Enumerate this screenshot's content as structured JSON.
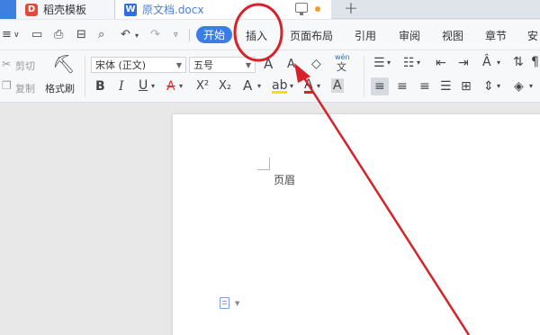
{
  "tabs": [
    {
      "label": "稻壳模板",
      "logo": "D"
    },
    {
      "label": "原文档.docx",
      "logo": "W"
    }
  ],
  "tab_bar": {
    "plus": "+"
  },
  "menu": {
    "start": "开始",
    "items": [
      "插入",
      "页面布局",
      "引用",
      "审阅",
      "视图",
      "章节",
      "安"
    ]
  },
  "clipboard": {
    "cut": "剪切",
    "copy": "复制",
    "format_painter": "格式刷"
  },
  "font": {
    "family": "宋体 (正文)",
    "size": "五号"
  },
  "ribbon_glyphs": {
    "bold": "B",
    "italic": "I",
    "underline": "U",
    "strike": "A",
    "superscript": "X²",
    "subscript": "X₂",
    "grow": "A",
    "shrink": "A",
    "phonetic": "wén",
    "phonetic_char": "文",
    "text_effect": "A",
    "highlight": "ab",
    "font_color": "A",
    "char_shading": "A"
  },
  "document": {
    "header_label": "页眉"
  },
  "colors": {
    "accent": "#3b7de8",
    "annotation": "#d6232a",
    "docer_logo": "#e5473b",
    "writer_logo": "#2f6fe0"
  }
}
